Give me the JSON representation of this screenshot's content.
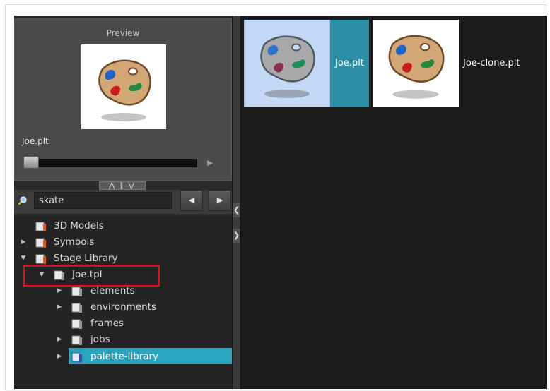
{
  "preview": {
    "title": "Preview",
    "name": "Joe.plt",
    "play_icon": "play-icon"
  },
  "splitter": {
    "label": "⋀ ∥ ⋁"
  },
  "search": {
    "value": "skate",
    "prev_icon": "chevron-left-icon",
    "next_icon": "chevron-right-icon"
  },
  "tree": {
    "items": [
      {
        "label": "3D Models",
        "expand": ""
      },
      {
        "label": "Symbols",
        "expand": "▶"
      },
      {
        "label": "Stage Library",
        "expand": "▼"
      },
      {
        "label": "Joe.tpl",
        "expand": "▼"
      },
      {
        "label": "elements",
        "expand": "▶"
      },
      {
        "label": "environments",
        "expand": "▶"
      },
      {
        "label": "frames",
        "expand": ""
      },
      {
        "label": "jobs",
        "expand": "▶"
      },
      {
        "label": "palette-library",
        "expand": "▶"
      }
    ]
  },
  "palettes": [
    {
      "name": "Joe.plt"
    },
    {
      "name": "Joe-clone.plt"
    }
  ],
  "colors": {
    "selection": "#2aa3bd",
    "highlight_box": "#e0101a",
    "tile_selected": "#c3d9f5"
  }
}
